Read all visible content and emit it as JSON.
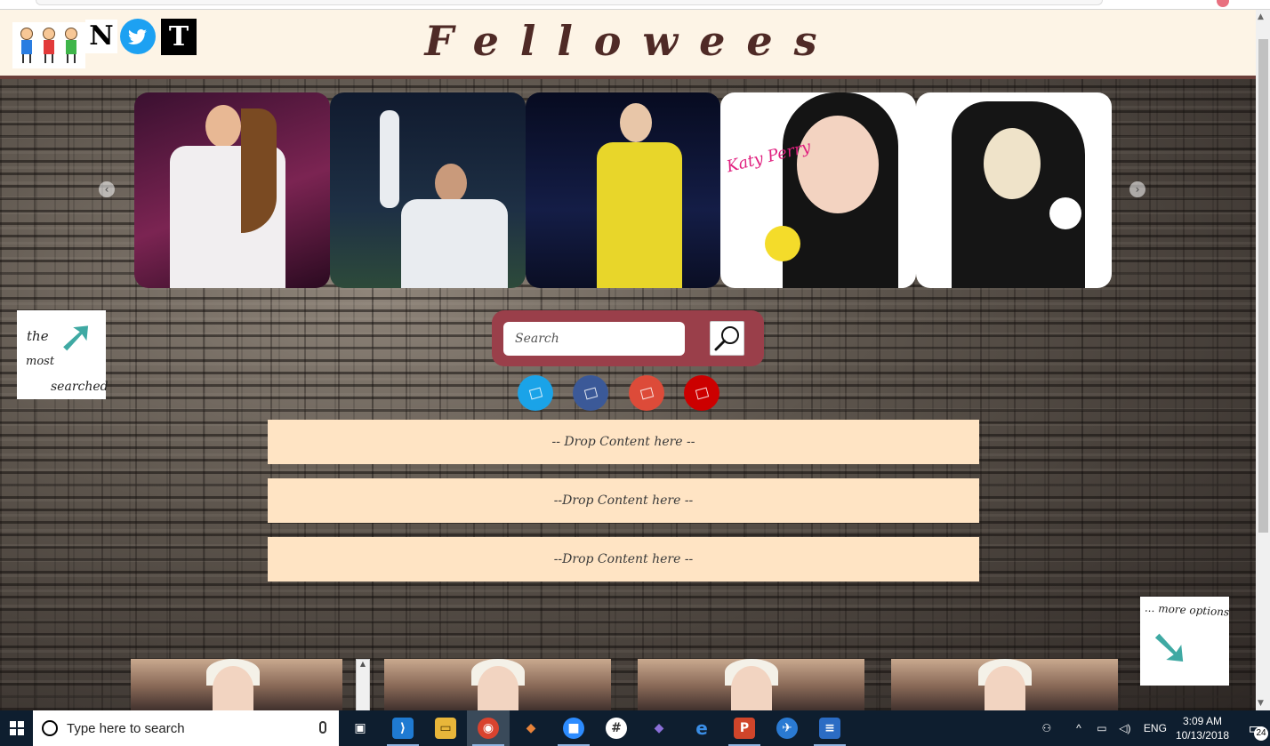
{
  "site": {
    "title": "Fellowees",
    "header_icons": [
      "kids-logo-icon",
      "n-icon",
      "twitter-icon",
      "nyt-icon"
    ],
    "n_letter": "N",
    "nyt_letter": "T",
    "brand_color": "#4f2a26"
  },
  "carousel": {
    "prev": "‹",
    "next": "›",
    "slides": [
      {
        "name": "slide-singer-white-hoodie",
        "text": ""
      },
      {
        "name": "slide-footballer-waving",
        "text": ""
      },
      {
        "name": "slide-singer-yellow-hoodie",
        "text": ""
      },
      {
        "name": "slide-katy-perry",
        "text": "Katy Perry"
      },
      {
        "name": "slide-lady-gaga",
        "text": ""
      }
    ]
  },
  "notes": {
    "most_searched": {
      "line1": "the",
      "line2": "most",
      "line3": "searched",
      "arrow": "➚"
    },
    "more_options": {
      "text": "... more options",
      "arrow": "➘"
    }
  },
  "search": {
    "placeholder": "Search",
    "value": "",
    "button_icon": "magnifier-icon"
  },
  "social": [
    {
      "name": "social-twitter-button",
      "color": "#1aa3e8"
    },
    {
      "name": "social-facebook-button",
      "color": "#3b5998"
    },
    {
      "name": "social-googleplus-button",
      "color": "#dd4b39"
    },
    {
      "name": "social-youtube-button",
      "color": "#cc0000"
    }
  ],
  "drop_zones": [
    "-- Drop Content here --",
    "--Drop Content here --",
    "--Drop Content here --"
  ],
  "taskbar": {
    "search_placeholder": "Type here to search",
    "apps": [
      {
        "name": "task-view-icon",
        "glyph": "▣"
      },
      {
        "name": "vscode-icon",
        "glyph": "⟩"
      },
      {
        "name": "file-explorer-icon",
        "glyph": "▭"
      },
      {
        "name": "chrome-icon",
        "glyph": "◉"
      },
      {
        "name": "git-icon",
        "glyph": "◆"
      },
      {
        "name": "zoom-icon",
        "glyph": "■"
      },
      {
        "name": "slack-icon",
        "glyph": "#"
      },
      {
        "name": "git-kraken-icon",
        "glyph": "◆"
      },
      {
        "name": "edge-icon",
        "glyph": "e"
      },
      {
        "name": "powerpoint-icon",
        "glyph": "P"
      },
      {
        "name": "sourcetree-icon",
        "glyph": "✈"
      },
      {
        "name": "notepad-icon",
        "glyph": "≡"
      }
    ],
    "tray": {
      "people": "⚇",
      "chevron": "^",
      "network": "▭",
      "volume": "◁)",
      "lang": "ENG",
      "time": "3:09 AM",
      "date": "10/13/2018",
      "notifications": "24"
    }
  }
}
